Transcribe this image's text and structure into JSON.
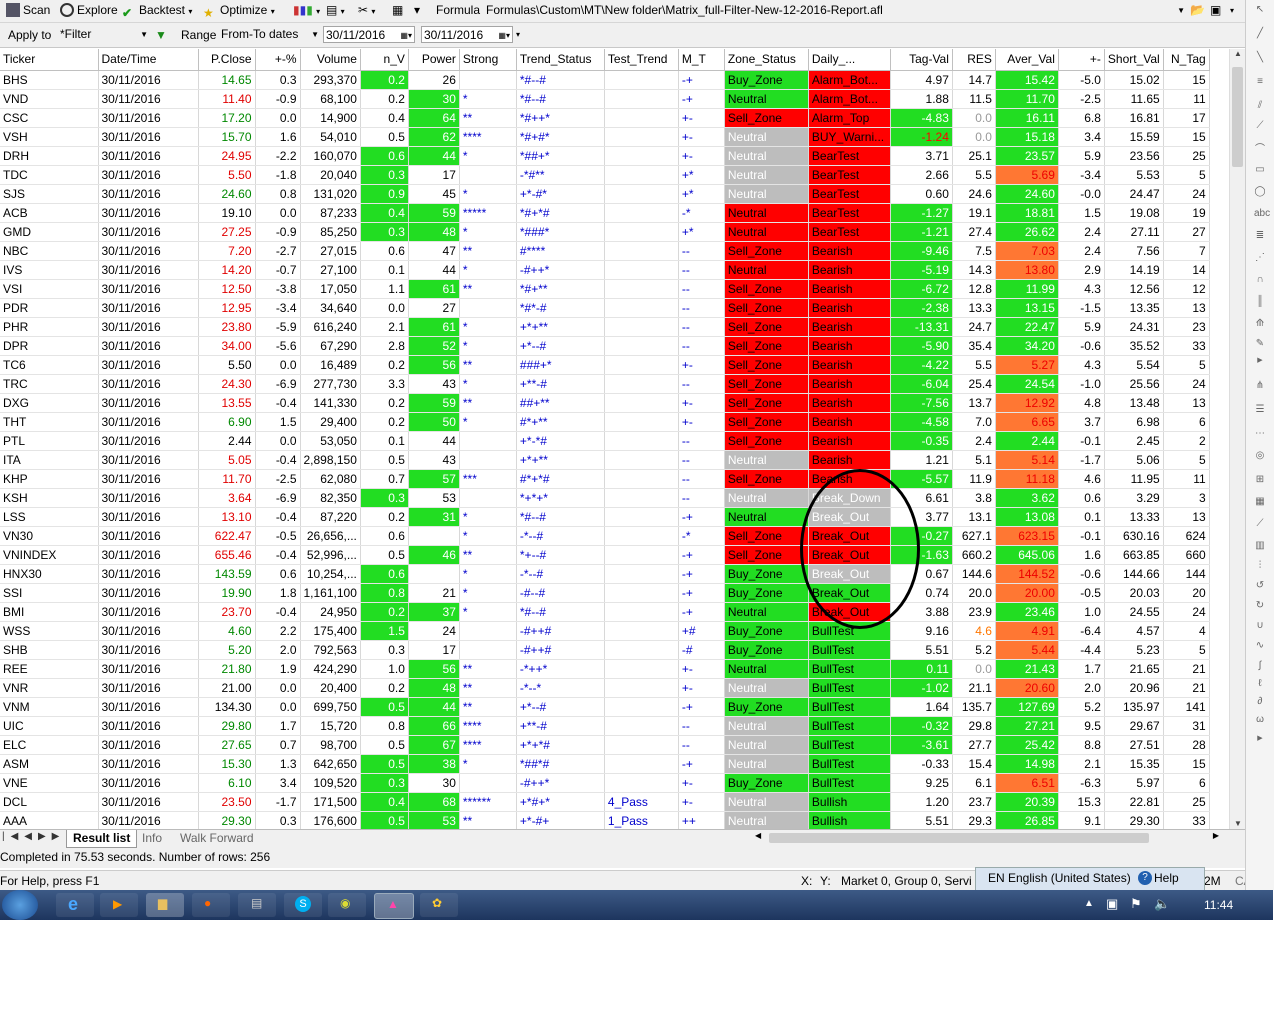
{
  "toolbar": {
    "scan": "Scan",
    "explore": "Explore",
    "backtest": "Backtest",
    "optimize": "Optimize",
    "formula_label": "Formula",
    "formula_path": "Formulas\\Custom\\MT\\New folder\\Matrix_full-Filter-New-12-2016-Report.afl"
  },
  "filterbar": {
    "apply_to_label": "Apply to",
    "apply_to_value": "*Filter",
    "range_label": "Range",
    "range_value": "From-To dates",
    "date_from": "30/11/2016",
    "date_to": "30/11/2016"
  },
  "columns": [
    "Ticker",
    "Date/Time",
    "P.Close",
    "+-%",
    "Volume",
    "n_V",
    "Power",
    "Strong",
    "Trend_Status",
    "Test_Trend",
    "M_T",
    "Zone_Status",
    "Daily_...",
    "Tag-Val",
    "RES",
    "Aver_Val",
    "+-",
    "Short_Val",
    "N_Tag"
  ],
  "rows": [
    [
      "BHS",
      "30/11/2016",
      "14.65",
      "0.3",
      "293,370",
      "0.2",
      "26",
      "",
      "*#--#",
      "",
      "-+",
      "Buy_Zone",
      "Alarm_Bot...",
      "4.97",
      "14.7",
      "15.42",
      "-5.0",
      "15.02",
      "15"
    ],
    [
      "VND",
      "30/11/2016",
      "11.40",
      "-0.9",
      "68,100",
      "0.2",
      "30",
      "*",
      "*#--#",
      "",
      "-+",
      "Neutral",
      "Alarm_Bot...",
      "1.88",
      "11.5",
      "11.70",
      "-2.5",
      "11.65",
      "11"
    ],
    [
      "CSC",
      "30/11/2016",
      "17.20",
      "0.0",
      "14,900",
      "0.4",
      "64",
      "**",
      "*#++*",
      "",
      "+-",
      "Sell_Zone",
      "Alarm_Top",
      "-4.83",
      "0.0",
      "16.11",
      "6.8",
      "16.81",
      "17"
    ],
    [
      "VSH",
      "30/11/2016",
      "15.70",
      "1.6",
      "54,010",
      "0.5",
      "62",
      "****",
      "*#+#*",
      "",
      "+-",
      "Neutral",
      "BUY_Warni...",
      "-1.24",
      "0.0",
      "15.18",
      "3.4",
      "15.59",
      "15"
    ],
    [
      "DRH",
      "30/11/2016",
      "24.95",
      "-2.2",
      "160,070",
      "0.6",
      "44",
      "*",
      "*##+*",
      "",
      "+-",
      "Neutral",
      "BearTest",
      "3.71",
      "25.1",
      "23.57",
      "5.9",
      "23.56",
      "25"
    ],
    [
      "TDC",
      "30/11/2016",
      "5.50",
      "-1.8",
      "20,040",
      "0.3",
      "17",
      "",
      "-*#**",
      "",
      "+*",
      "Neutral",
      "BearTest",
      "2.66",
      "5.5",
      "5.69",
      "-3.4",
      "5.53",
      "5"
    ],
    [
      "SJS",
      "30/11/2016",
      "24.60",
      "0.8",
      "131,020",
      "0.9",
      "45",
      "*",
      "+*-#*",
      "",
      "+*",
      "Neutral",
      "BearTest",
      "0.60",
      "24.6",
      "24.60",
      "-0.0",
      "24.47",
      "24"
    ],
    [
      "ACB",
      "30/11/2016",
      "19.10",
      "0.0",
      "87,233",
      "0.4",
      "59",
      "*****",
      "*#+*#",
      "",
      "-*",
      "Neutral",
      "BearTest",
      "-1.27",
      "19.1",
      "18.81",
      "1.5",
      "19.08",
      "19"
    ],
    [
      "GMD",
      "30/11/2016",
      "27.25",
      "-0.9",
      "85,250",
      "0.3",
      "48",
      "*",
      "*###*",
      "",
      "+*",
      "Neutral",
      "BearTest",
      "-1.21",
      "27.4",
      "26.62",
      "2.4",
      "27.11",
      "27"
    ],
    [
      "NBC",
      "30/11/2016",
      "7.20",
      "-2.7",
      "27,015",
      "0.6",
      "47",
      "**",
      "#****",
      "",
      "--",
      "Sell_Zone",
      "Bearish",
      "-9.46",
      "7.5",
      "7.03",
      "2.4",
      "7.56",
      "7"
    ],
    [
      "IVS",
      "30/11/2016",
      "14.20",
      "-0.7",
      "27,100",
      "0.1",
      "44",
      "*",
      "-#++*",
      "",
      "--",
      "Neutral",
      "Bearish",
      "-5.19",
      "14.3",
      "13.80",
      "2.9",
      "14.19",
      "14"
    ],
    [
      "VSI",
      "30/11/2016",
      "12.50",
      "-3.8",
      "17,050",
      "1.1",
      "61",
      "**",
      "*#+**",
      "",
      "--",
      "Sell_Zone",
      "Bearish",
      "-6.72",
      "12.8",
      "11.99",
      "4.3",
      "12.56",
      "12"
    ],
    [
      "PDR",
      "30/11/2016",
      "12.95",
      "-3.4",
      "34,640",
      "0.0",
      "27",
      "",
      "*#*-#",
      "",
      "--",
      "Sell_Zone",
      "Bearish",
      "-2.38",
      "13.3",
      "13.15",
      "-1.5",
      "13.35",
      "13"
    ],
    [
      "PHR",
      "30/11/2016",
      "23.80",
      "-5.9",
      "616,240",
      "2.1",
      "61",
      "*",
      "+*+**",
      "",
      "--",
      "Sell_Zone",
      "Bearish",
      "-13.31",
      "24.7",
      "22.47",
      "5.9",
      "24.31",
      "23"
    ],
    [
      "DPR",
      "30/11/2016",
      "34.00",
      "-5.6",
      "67,290",
      "2.8",
      "52",
      "*",
      "+*--#",
      "",
      "--",
      "Sell_Zone",
      "Bearish",
      "-5.90",
      "35.4",
      "34.20",
      "-0.6",
      "35.52",
      "33"
    ],
    [
      "TC6",
      "30/11/2016",
      "5.50",
      "0.0",
      "16,489",
      "0.2",
      "56",
      "**",
      "###+*",
      "",
      "+-",
      "Sell_Zone",
      "Bearish",
      "-4.22",
      "5.5",
      "5.27",
      "4.3",
      "5.54",
      "5"
    ],
    [
      "TRC",
      "30/11/2016",
      "24.30",
      "-6.9",
      "277,730",
      "3.3",
      "43",
      "*",
      "+**-#",
      "",
      "--",
      "Sell_Zone",
      "Bearish",
      "-6.04",
      "25.4",
      "24.54",
      "-1.0",
      "25.56",
      "24"
    ],
    [
      "DXG",
      "30/11/2016",
      "13.55",
      "-0.4",
      "141,330",
      "0.2",
      "59",
      "**",
      "##+**",
      "",
      "+-",
      "Sell_Zone",
      "Bearish",
      "-7.56",
      "13.7",
      "12.92",
      "4.8",
      "13.48",
      "13"
    ],
    [
      "THT",
      "30/11/2016",
      "6.90",
      "1.5",
      "29,400",
      "0.2",
      "50",
      "*",
      "#*+**",
      "",
      "+-",
      "Sell_Zone",
      "Bearish",
      "-4.58",
      "7.0",
      "6.65",
      "3.7",
      "6.98",
      "6"
    ],
    [
      "PTL",
      "30/11/2016",
      "2.44",
      "0.0",
      "53,050",
      "0.1",
      "44",
      "",
      "+*-*#",
      "",
      "--",
      "Sell_Zone",
      "Bearish",
      "-0.35",
      "2.4",
      "2.44",
      "-0.1",
      "2.45",
      "2"
    ],
    [
      "ITA",
      "30/11/2016",
      "5.05",
      "-0.4",
      "2,898,150",
      "0.5",
      "43",
      "",
      "+*+**",
      "",
      "--",
      "Neutral",
      "Bearish",
      "1.21",
      "5.1",
      "5.14",
      "-1.7",
      "5.06",
      "5"
    ],
    [
      "KHP",
      "30/11/2016",
      "11.70",
      "-2.5",
      "62,080",
      "0.7",
      "57",
      "***",
      "#*+*#",
      "",
      "--",
      "Sell_Zone",
      "Bearish",
      "-5.57",
      "11.9",
      "11.18",
      "4.6",
      "11.95",
      "11"
    ],
    [
      "KSH",
      "30/11/2016",
      "3.64",
      "-6.9",
      "82,350",
      "0.3",
      "53",
      "",
      "*+*+*",
      "",
      "--",
      "Neutral",
      "Break_Down",
      "6.61",
      "3.8",
      "3.62",
      "0.6",
      "3.29",
      "3"
    ],
    [
      "LSS",
      "30/11/2016",
      "13.10",
      "-0.4",
      "87,220",
      "0.2",
      "31",
      "*",
      "*#--#",
      "",
      "-+",
      "Neutral",
      "Break_Out",
      "3.77",
      "13.1",
      "13.08",
      "0.1",
      "13.33",
      "13"
    ],
    [
      "VN30",
      "30/11/2016",
      "622.47",
      "-0.5",
      "26,656,...",
      "0.6",
      "",
      "*",
      "-*--#",
      "",
      "-*",
      "Sell_Zone",
      "Break_Out",
      "-0.27",
      "627.1",
      "623.15",
      "-0.1",
      "630.16",
      "624"
    ],
    [
      "VNINDEX",
      "30/11/2016",
      "655.46",
      "-0.4",
      "52,996,...",
      "0.5",
      "46",
      "**",
      "*+--#",
      "",
      "-+",
      "Sell_Zone",
      "Break_Out",
      "-1.63",
      "660.2",
      "645.06",
      "1.6",
      "663.85",
      "660"
    ],
    [
      "HNX30",
      "30/11/2016",
      "143.59",
      "0.6",
      "10,254,...",
      "0.6",
      "",
      "*",
      "-*--#",
      "",
      "-+",
      "Buy_Zone",
      "Break_Out",
      "0.67",
      "144.6",
      "144.52",
      "-0.6",
      "144.66",
      "144"
    ],
    [
      "SSI",
      "30/11/2016",
      "19.90",
      "1.8",
      "1,161,100",
      "0.8",
      "21",
      "*",
      "-#--#",
      "",
      "-+",
      "Buy_Zone",
      "Break_Out",
      "0.74",
      "20.0",
      "20.00",
      "-0.5",
      "20.03",
      "20"
    ],
    [
      "BMI",
      "30/11/2016",
      "23.70",
      "-0.4",
      "24,950",
      "0.2",
      "37",
      "*",
      "*#--#",
      "",
      "-+",
      "Neutral",
      "Break_Out",
      "3.88",
      "23.9",
      "23.46",
      "1.0",
      "24.55",
      "24"
    ],
    [
      "WSS",
      "30/11/2016",
      "4.60",
      "2.2",
      "175,400",
      "1.5",
      "24",
      "",
      "-#++#",
      "",
      "+#",
      "Buy_Zone",
      "BullTest",
      "9.16",
      "4.6",
      "4.91",
      "-6.4",
      "4.57",
      "4"
    ],
    [
      "SHB",
      "30/11/2016",
      "5.20",
      "2.0",
      "792,563",
      "0.3",
      "17",
      "",
      "-#++#",
      "",
      "-#",
      "Buy_Zone",
      "BullTest",
      "5.51",
      "5.2",
      "5.44",
      "-4.4",
      "5.23",
      "5"
    ],
    [
      "REE",
      "30/11/2016",
      "21.80",
      "1.9",
      "424,290",
      "1.0",
      "56",
      "**",
      "-*++*",
      "",
      "+-",
      "Neutral",
      "BullTest",
      "0.11",
      "0.0",
      "21.43",
      "1.7",
      "21.65",
      "21"
    ],
    [
      "VNR",
      "30/11/2016",
      "21.00",
      "0.0",
      "20,400",
      "0.2",
      "48",
      "**",
      "-*--*",
      "",
      "+-",
      "Neutral",
      "BullTest",
      "-1.02",
      "21.1",
      "20.60",
      "2.0",
      "20.96",
      "21"
    ],
    [
      "VNM",
      "30/11/2016",
      "134.30",
      "0.0",
      "699,750",
      "0.5",
      "44",
      "**",
      "+*--#",
      "",
      "-+",
      "Buy_Zone",
      "BullTest",
      "1.64",
      "135.7",
      "127.69",
      "5.2",
      "135.97",
      "141"
    ],
    [
      "UIC",
      "30/11/2016",
      "29.80",
      "1.7",
      "15,720",
      "0.8",
      "66",
      "****",
      "+**-#",
      "",
      "--",
      "Neutral",
      "BullTest",
      "-0.32",
      "29.8",
      "27.21",
      "9.5",
      "29.67",
      "31"
    ],
    [
      "ELC",
      "30/11/2016",
      "27.65",
      "0.7",
      "98,700",
      "0.5",
      "67",
      "****",
      "+*+*#",
      "",
      "--",
      "Neutral",
      "BullTest",
      "-3.61",
      "27.7",
      "25.42",
      "8.8",
      "27.51",
      "28"
    ],
    [
      "ASM",
      "30/11/2016",
      "15.30",
      "1.3",
      "642,650",
      "0.5",
      "38",
      "*",
      "*##*#",
      "",
      "-+",
      "Neutral",
      "BullTest",
      "-0.33",
      "15.4",
      "14.98",
      "2.1",
      "15.35",
      "15"
    ],
    [
      "VNE",
      "30/11/2016",
      "6.10",
      "3.4",
      "109,520",
      "0.3",
      "30",
      "",
      "-#++*",
      "",
      "+-",
      "Buy_Zone",
      "BullTest",
      "9.25",
      "6.1",
      "6.51",
      "-6.3",
      "5.97",
      "6"
    ],
    [
      "DCL",
      "30/11/2016",
      "23.50",
      "-1.7",
      "171,500",
      "0.4",
      "68",
      "******",
      "+*#+*",
      "4_Pass",
      "+-",
      "Neutral",
      "Bullish",
      "1.20",
      "23.7",
      "20.39",
      "15.3",
      "22.81",
      "25"
    ],
    [
      "AAA",
      "30/11/2016",
      "29.30",
      "0.3",
      "176,600",
      "0.5",
      "53",
      "**",
      "+*-#+",
      "1_Pass",
      "++",
      "Neutral",
      "Bullish",
      "5.51",
      "29.3",
      "26.85",
      "9.1",
      "29.30",
      "33"
    ]
  ],
  "row_styles": [
    {
      "pc": "g",
      "nv": "r",
      "pw": "",
      "zs": "g",
      "dl": "r",
      "tv": "",
      "rs": "",
      "av": "r",
      "pm": "r"
    },
    {
      "pc": "r",
      "nv": "",
      "pw": "g",
      "zs": "g",
      "dl": "r",
      "tv": "",
      "rs": "",
      "av": "r",
      "pm": "r"
    },
    {
      "pc": "g",
      "nv": "",
      "pw": "r",
      "zs": "r",
      "dl": "r",
      "tv": "r",
      "rs": "gv",
      "av": "g",
      "pm": "g"
    },
    {
      "pc": "g",
      "nv": "",
      "pw": "r",
      "zs": "gr",
      "dl": "r",
      "tv": "g",
      "rs": "gv",
      "av": "g",
      "pm": "g"
    },
    {
      "pc": "r",
      "nv": "g",
      "pw": "g",
      "zs": "gr",
      "dl": "r",
      "tv": "",
      "rs": "",
      "av": "g",
      "pm": "g"
    },
    {
      "pc": "r",
      "nv": "g",
      "pw": "",
      "zs": "gr",
      "dl": "r",
      "tv": "",
      "rs": "",
      "av": "o",
      "pm": "r"
    },
    {
      "pc": "g",
      "nv": "r",
      "pw": "",
      "zs": "gr",
      "dl": "r",
      "tv": "",
      "rs": "",
      "av": "g",
      "pm": "r"
    },
    {
      "pc": "",
      "nv": "r",
      "pw": "r",
      "zs": "r",
      "dl": "r",
      "tv": "r",
      "rs": "",
      "av": "g",
      "pm": "g"
    },
    {
      "pc": "r",
      "nv": "g",
      "pw": "r",
      "zs": "r",
      "dl": "r",
      "tv": "r",
      "rs": "",
      "av": "g",
      "pm": "g"
    },
    {
      "pc": "r",
      "nv": "",
      "pw": "",
      "zs": "r",
      "dl": "r",
      "tv": "r",
      "rs": "",
      "av": "o",
      "pm": "g"
    },
    {
      "pc": "r",
      "nv": "",
      "pw": "",
      "zs": "r",
      "dl": "r",
      "tv": "r",
      "rs": "",
      "av": "o",
      "pm": "g"
    },
    {
      "pc": "r",
      "nv": "",
      "pw": "g",
      "zs": "r",
      "dl": "r",
      "tv": "r",
      "rs": "",
      "av": "g",
      "pm": "g"
    },
    {
      "pc": "r",
      "nv": "",
      "pw": "",
      "zs": "r",
      "dl": "r",
      "tv": "r",
      "rs": "",
      "av": "g",
      "pm": "r"
    },
    {
      "pc": "r",
      "nv": "",
      "pw": "g",
      "zs": "r",
      "dl": "r",
      "tv": "r",
      "rs": "",
      "av": "g",
      "pm": "g"
    },
    {
      "pc": "r",
      "nv": "",
      "pw": "g",
      "zs": "r",
      "dl": "r",
      "tv": "r",
      "rs": "",
      "av": "g",
      "pm": "r"
    },
    {
      "pc": "",
      "nv": "",
      "pw": "g",
      "zs": "r",
      "dl": "r",
      "tv": "r",
      "rs": "",
      "av": "o",
      "pm": "g"
    },
    {
      "pc": "r",
      "nv": "",
      "pw": "",
      "zs": "r",
      "dl": "r",
      "tv": "r",
      "rs": "",
      "av": "g",
      "pm": "r"
    },
    {
      "pc": "r",
      "nv": "",
      "pw": "g",
      "zs": "r",
      "dl": "r",
      "tv": "r",
      "rs": "",
      "av": "o",
      "pm": "g"
    },
    {
      "pc": "g",
      "nv": "",
      "pw": "g",
      "zs": "r",
      "dl": "r",
      "tv": "r",
      "rs": "",
      "av": "o",
      "pm": "g"
    },
    {
      "pc": "",
      "nv": "",
      "pw": "",
      "zs": "r",
      "dl": "r",
      "tv": "r",
      "rs": "",
      "av": "g",
      "pm": "r"
    },
    {
      "pc": "r",
      "nv": "",
      "pw": "",
      "zs": "gr",
      "dl": "r",
      "tv": "",
      "rs": "",
      "av": "o",
      "pm": "r"
    },
    {
      "pc": "r",
      "nv": "",
      "pw": "g",
      "zs": "r",
      "dl": "r",
      "tv": "r",
      "rs": "",
      "av": "o",
      "pm": "g"
    },
    {
      "pc": "r",
      "nv": "g",
      "pw": "",
      "zs": "gr",
      "dl": "gr",
      "tv": "",
      "rs": "",
      "av": "g",
      "pm": "g"
    },
    {
      "pc": "r",
      "nv": "",
      "pw": "g",
      "zs": "g",
      "dl": "gr",
      "tv": "",
      "rs": "",
      "av": "g",
      "pm": "g"
    },
    {
      "pc": "r",
      "nv": "",
      "pw": "",
      "zs": "r",
      "dl": "r",
      "tv": "r",
      "rs": "",
      "av": "o",
      "pm": "r"
    },
    {
      "pc": "r",
      "nv": "",
      "pw": "r",
      "zs": "r",
      "dl": "r",
      "tv": "r",
      "rs": "",
      "av": "g",
      "pm": "g"
    },
    {
      "pc": "g",
      "nv": "r",
      "pw": "",
      "zs": "g",
      "dl": "gr",
      "tv": "",
      "rs": "",
      "av": "o",
      "pm": "r"
    },
    {
      "pc": "g",
      "nv": "r",
      "pw": "",
      "zs": "g",
      "dl": "g",
      "tv": "",
      "rs": "",
      "av": "o",
      "pm": "r"
    },
    {
      "pc": "r",
      "nv": "r",
      "pw": "g",
      "zs": "g",
      "dl": "r",
      "tv": "",
      "rs": "",
      "av": "g",
      "pm": "g"
    },
    {
      "pc": "g",
      "nv": "g",
      "pw": "",
      "zs": "g",
      "dl": "g",
      "tv": "",
      "rs": "o",
      "av": "o",
      "pm": "r"
    },
    {
      "pc": "g",
      "nv": "",
      "pw": "",
      "zs": "g",
      "dl": "g",
      "tv": "",
      "rs": "",
      "av": "o",
      "pm": "r"
    },
    {
      "pc": "g",
      "nv": "",
      "pw": "r",
      "zs": "g",
      "dl": "g",
      "tv": "r",
      "rs": "gv",
      "av": "g",
      "pm": "g"
    },
    {
      "pc": "",
      "nv": "",
      "pw": "r",
      "zs": "gr",
      "dl": "g",
      "tv": "r",
      "rs": "",
      "av": "o",
      "pm": "g"
    },
    {
      "pc": "",
      "nv": "g",
      "pw": "g",
      "zs": "g",
      "dl": "g",
      "tv": "",
      "rs": "",
      "av": "g",
      "pm": "g"
    },
    {
      "pc": "g",
      "nv": "",
      "pw": "r",
      "zs": "gr",
      "dl": "g",
      "tv": "r",
      "rs": "",
      "av": "g",
      "pm": "g"
    },
    {
      "pc": "g",
      "nv": "",
      "pw": "r",
      "zs": "gr",
      "dl": "g",
      "tv": "r",
      "rs": "",
      "av": "g",
      "pm": "g"
    },
    {
      "pc": "g",
      "nv": "g",
      "pw": "g",
      "zs": "gr",
      "dl": "g",
      "tv": "",
      "rs": "",
      "av": "g",
      "pm": "g"
    },
    {
      "pc": "g",
      "nv": "g",
      "pw": "",
      "zs": "g",
      "dl": "g",
      "tv": "",
      "rs": "",
      "av": "o",
      "pm": "r"
    },
    {
      "pc": "r",
      "nv": "g",
      "pw": "r",
      "zs": "gr",
      "dl": "g",
      "tv": "",
      "rs": "",
      "av": "g",
      "pm": "g"
    },
    {
      "pc": "g",
      "nv": "g",
      "pw": "r",
      "zs": "gr",
      "dl": "g",
      "tv": "",
      "rs": "",
      "av": "g",
      "pm": "g"
    }
  ],
  "tabs": {
    "result_list": "Result list",
    "info": "Info",
    "walk_forward": "Walk Forward"
  },
  "completed": "Completed in 75.53 seconds. Number of rows: 256",
  "statusbar": {
    "help": "For Help, press F1",
    "x": "X:",
    "y": "Y:",
    "market": "Market 0, Group 0, Servi",
    "mem": "2M",
    "cap": "CAP"
  },
  "langbar": {
    "lang": "EN English (United States)",
    "help": "Help"
  },
  "clock": "11:44",
  "colors": {
    "green": "#22dd22",
    "red": "#ff0000",
    "orange": "#ff7733",
    "gray": "#bdbdbd"
  }
}
